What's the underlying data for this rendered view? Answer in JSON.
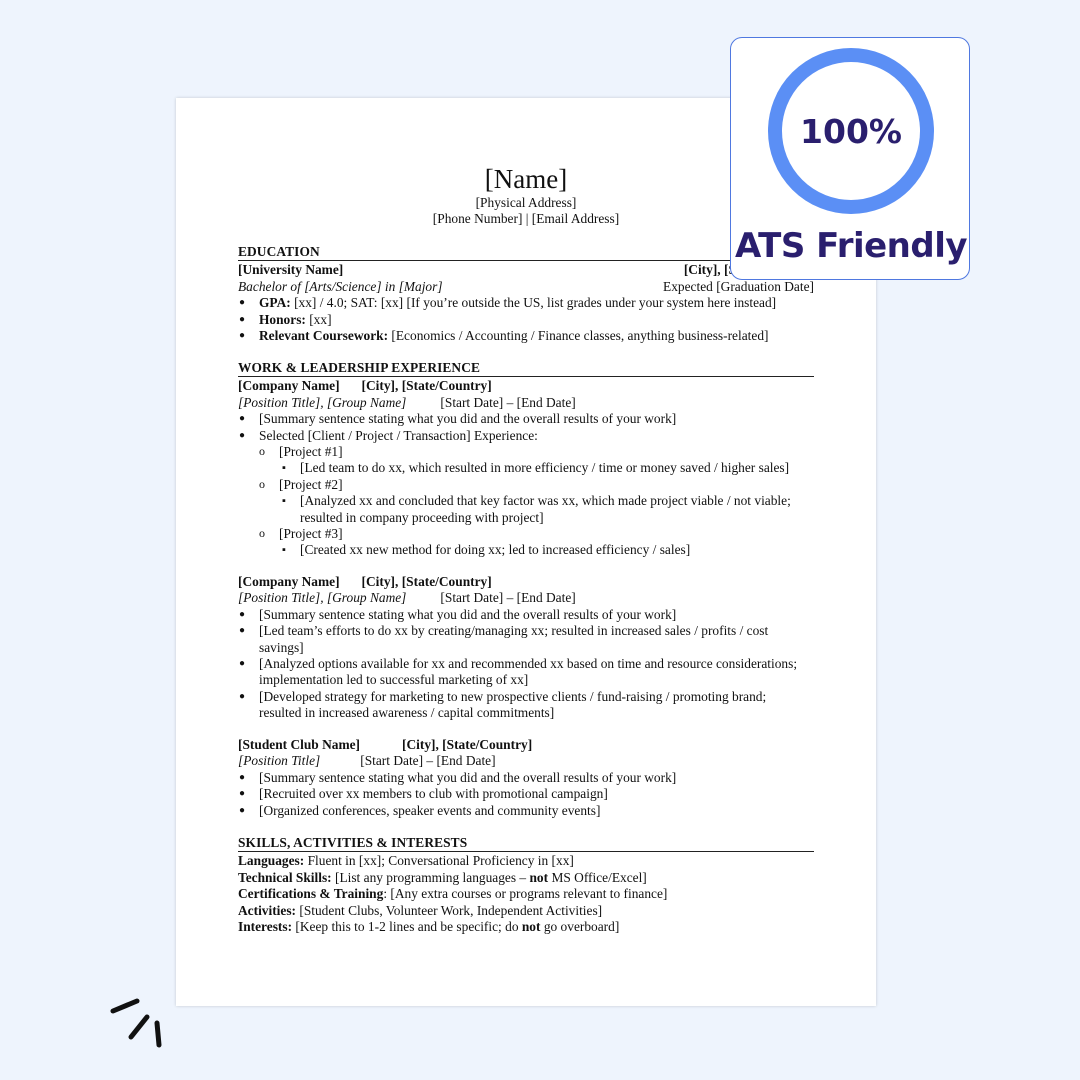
{
  "header": {
    "name": "[Name]",
    "address": "[Physical Address]",
    "contact": "[Phone Number] | [Email Address]"
  },
  "education": {
    "title": "EDUCATION",
    "university": "[University Name]",
    "location": "[City], [State/Country]",
    "degree": "Bachelor of [Arts/Science] in [Major]",
    "graduation": "Expected [Graduation Date]",
    "gpa_label": "GPA:",
    "gpa_text": " [xx] / 4.0; SAT: [xx] [If you’re outside the US, list grades under your system here instead]",
    "honors_label": "Honors:",
    "honors_text": " [xx]",
    "coursework_label": "Relevant Coursework:",
    "coursework_text": " [Economics / Accounting / Finance classes, anything business-related]"
  },
  "work": {
    "title": "WORK & LEADERSHIP EXPERIENCE",
    "job1": {
      "company": "[Company Name]",
      "location": "[City], [State/Country]",
      "position": "[Position Title], [Group Name]",
      "dates": "[Start Date] – [End Date]",
      "summary": "[Summary sentence stating what you did and the overall results of your work]",
      "selected": "Selected [Client / Project / Transaction] Experience:",
      "project1": "[Project #1]",
      "project1_detail": "[Led team to do xx, which resulted in more efficiency / time or money saved / higher sales]",
      "project2": "[Project #2]",
      "project2_detail_l1": "[Analyzed xx and concluded that key factor was xx, which made project viable / not viable;",
      "project2_detail_l2": "resulted in company proceeding with project]",
      "project3": "[Project #3]",
      "project3_detail": "[Created xx new method for doing xx; led to increased efficiency / sales]"
    },
    "job2": {
      "company": "[Company Name]",
      "location": "[City], [State/Country]",
      "position": "[Position Title], [Group Name]",
      "dates": "[Start Date] – [End Date]",
      "b1": "[Summary sentence stating what you did and the overall results of your work]",
      "b2_l1": "[Led team’s efforts to do xx by creating/managing xx; resulted in increased sales / profits / cost",
      "b2_l2": "savings]",
      "b3_l1": "[Analyzed options available for xx and recommended xx based on time and resource considerations;",
      "b3_l2": "implementation led to successful marketing of xx]",
      "b4_l1": "[Developed strategy for marketing to new prospective clients / fund-raising / promoting brand;",
      "b4_l2": "resulted in increased awareness / capital commitments]"
    },
    "club": {
      "name": "[Student Club Name]",
      "location": "[City], [State/Country]",
      "position": "[Position Title]",
      "dates": "[Start Date] – [End Date]",
      "b1": "[Summary sentence stating what you did and the overall results of your work]",
      "b2": "[Recruited over xx members to club with promotional campaign]",
      "b3": "[Organized conferences, speaker events and community events]"
    }
  },
  "skills": {
    "title": "SKILLS, ACTIVITIES & INTERESTS",
    "languages_label": "Languages:",
    "languages_text": " Fluent in [xx]; Conversational Proficiency in [xx]",
    "technical_label": "Technical Skills:",
    "technical_text": " [List any programming languages – ",
    "technical_not": "not",
    "technical_tail": " MS Office/Excel]",
    "cert_label": "Certifications & Training",
    "cert_text": ": [Any extra courses or programs relevant to finance]",
    "activities_label": "Activities:",
    "activities_text": " [Student Clubs, Volunteer Work, Independent Activities]",
    "interests_label": "Interests:",
    "interests_text": " [Keep this to 1-2 lines and be specific; do ",
    "interests_not": "not",
    "interests_tail": " go overboard]"
  },
  "badge": {
    "percent": "100%",
    "label": "ATS Friendly",
    "ring_color": "#5b8ff5",
    "text_color": "#2a1f6e"
  }
}
